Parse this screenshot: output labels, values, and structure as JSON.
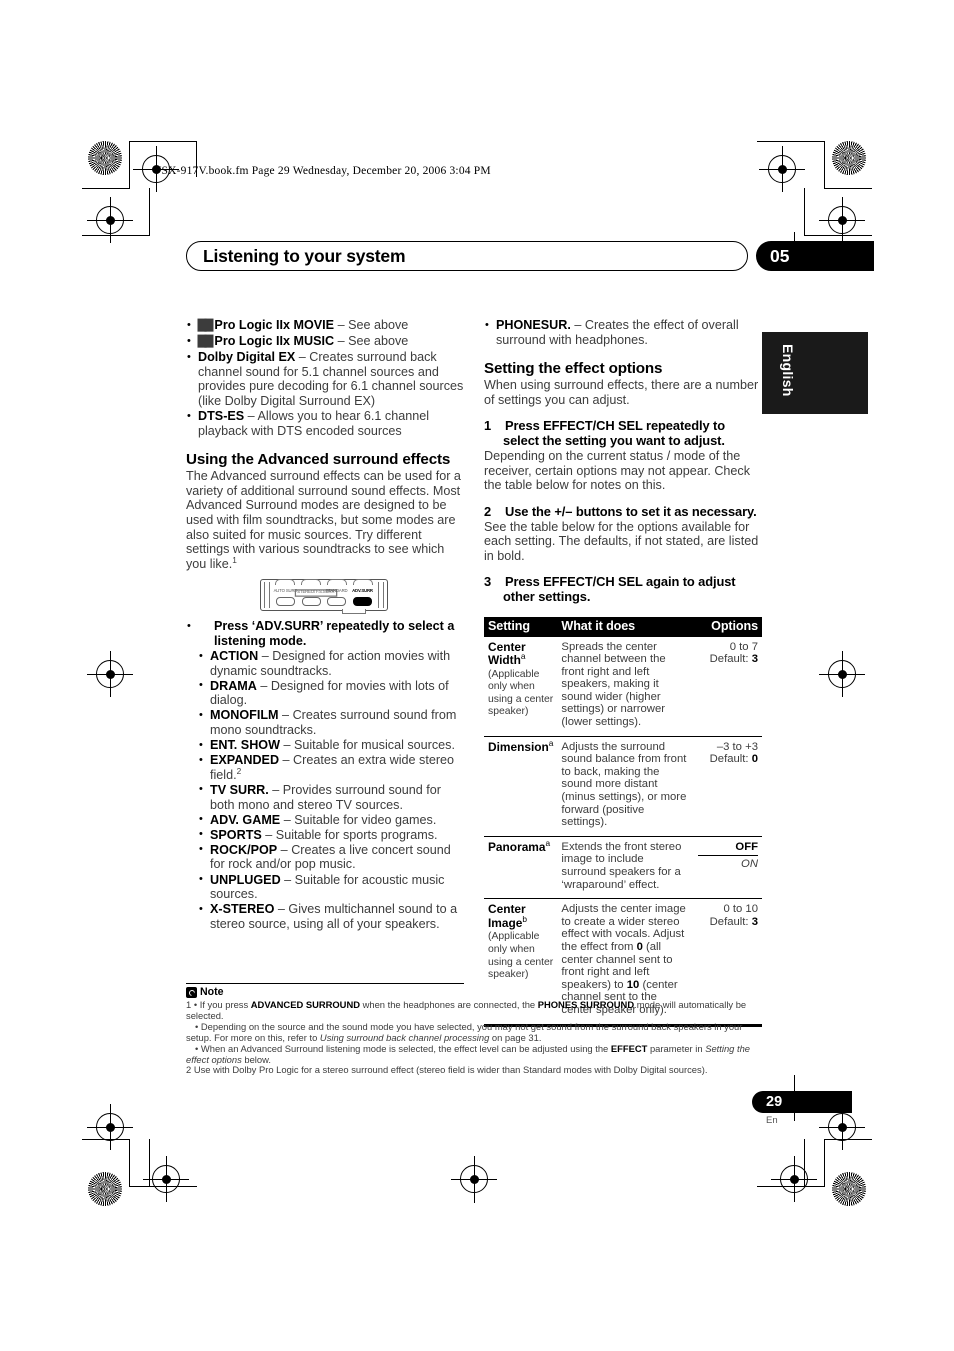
{
  "file_header": "VSX-917V.book.fm  Page 29  Wednesday, December 20, 2006  3:04 PM",
  "header": {
    "title": "Listening to your system",
    "chapter": "05",
    "language_tab": "English"
  },
  "footer": {
    "page_number": "29",
    "page_suffix": "En"
  },
  "left_column": {
    "mode_bullets": [
      {
        "dolby_symbol": "██",
        "term": "Pro Logic IIx MOVIE",
        "desc": " – See above"
      },
      {
        "dolby_symbol": "██",
        "term": "Pro Logic IIx MUSIC",
        "desc": " – See above"
      },
      {
        "dolby_symbol": "",
        "term": "Dolby Digital EX",
        "desc": " – Creates surround back channel sound for 5.1 channel sources and provides pure decoding for 6.1 channel sources (like Dolby Digital Surround EX)"
      },
      {
        "dolby_symbol": "",
        "term": "DTS-ES",
        "desc": " – Allows you to hear 6.1 channel playback with DTS encoded sources"
      }
    ],
    "section_heading": "Using the Advanced surround effects",
    "section_body_1": "The Advanced surround effects can be used for a variety of additional surround sound effects. Most Advanced Surround modes are designed to be used with film soundtracks, but some modes are also suited for music sources. Try different settings with various soundtracks to see which you like.",
    "section_body_1_footnote": "1",
    "remote": {
      "buttons": [
        {
          "label": "AUTO SURR",
          "active": false,
          "boxed": false
        },
        {
          "label": "STEREO/ F.S.SURR",
          "active": false,
          "boxed": true
        },
        {
          "label": "STANDARD",
          "active": false,
          "boxed": false
        },
        {
          "label": "ADV.SURR",
          "active": true,
          "boxed": false
        }
      ]
    },
    "instruction": "Press  ‘ADV.SURR’ repeatedly to select a listening mode.",
    "listening_modes": [
      {
        "term": "ACTION",
        "desc": " – Designed for action movies with dynamic soundtracks."
      },
      {
        "term": "DRAMA",
        "desc": " – Designed for movies with lots of dialog."
      },
      {
        "term": "MONOFILM",
        "desc": " – Creates surround sound from mono soundtracks."
      },
      {
        "term": "ENT. SHOW",
        "desc": " – Suitable for musical sources."
      },
      {
        "term": "EXPANDED",
        "desc": " – Creates an extra wide stereo field.",
        "footnote": "2"
      },
      {
        "term": "TV SURR.",
        "desc": " – Provides surround sound for both mono and stereo TV sources."
      },
      {
        "term": "ADV. GAME",
        "desc": " – Suitable for video games."
      },
      {
        "term": "SPORTS",
        "desc": " – Suitable for sports programs."
      },
      {
        "term": "ROCK/POP",
        "desc": " – Creates a live concert sound for rock and/or pop music."
      },
      {
        "term": "UNPLUGED",
        "desc": " – Suitable for acoustic music sources."
      },
      {
        "term": "X-STEREO",
        "desc": " – Gives multichannel sound to a stereo source, using all of your speakers."
      }
    ]
  },
  "right_column": {
    "phonesur": {
      "term": "PHONESUR.",
      "desc": " – Creates the effect of overall surround with headphones."
    },
    "section_heading": "Setting the effect options",
    "section_body": "When using surround effects, there are a number of settings you can adjust.",
    "steps": [
      {
        "num": "1",
        "title": "Press EFFECT/CH SEL repeatedly to select the setting you want to adjust.",
        "body": "Depending on the current status / mode of the receiver, certain options may not appear. Check the table below for notes on this."
      },
      {
        "num": "2",
        "title": "Use the +/– buttons to set it as necessary.",
        "body": "See the table below for the options available for each setting. The defaults, if not stated, are listed in bold."
      },
      {
        "num": "3",
        "title": "Press EFFECT/CH SEL again to adjust other settings.",
        "body": ""
      }
    ],
    "table": {
      "headers": [
        "Setting",
        "What it does",
        "Options"
      ],
      "rows": [
        {
          "setting_name": "Center Width",
          "setting_footnote": "a",
          "setting_note": "(Applicable only when using a center speaker)",
          "what": "Spreads the center channel between the front right and left speakers, making it sound wider (higher settings) or narrower (lower settings).",
          "options_range": "0 to 7",
          "options_default_label": "Default: ",
          "options_default_value": "3"
        },
        {
          "setting_name": "Dimension",
          "setting_footnote": "a",
          "setting_note": "",
          "what": "Adjusts the surround sound balance from front to back, making the sound more distant (minus settings), or more forward (positive settings).",
          "options_range": "–3 to +3",
          "options_default_label": "Default: ",
          "options_default_value": "0"
        },
        {
          "setting_name": "Panorama",
          "setting_footnote": "a",
          "setting_note": "",
          "what": "Extends the front stereo image to include surround speakers for a ‘wraparound’ effect.",
          "options_on_off": {
            "default": "OFF",
            "alternate": "ON"
          }
        },
        {
          "setting_name": "Center Image",
          "setting_footnote": "b",
          "setting_note": "(Applicable only when using a center speaker)",
          "what_part1": "Adjusts the center image to create a wider stereo effect with vocals. Adjust the effect from ",
          "what_bold1": "0",
          "what_part2": " (all center channel sent to front right and left speakers) to ",
          "what_bold2": "10",
          "what_part3": " (center channel sent to the center speaker only).",
          "options_range": "0 to 10",
          "options_default_label": "Default: ",
          "options_default_value": "3"
        }
      ]
    }
  },
  "notes": {
    "label": "Note",
    "items": [
      {
        "marker": "1",
        "text_parts": [
          "• If you press ",
          "ADVANCED SURROUND",
          " when the headphones are connected, the ",
          "PHONES SURROUND",
          " mode will automatically be selected."
        ]
      },
      {
        "marker": "",
        "text_parts": [
          "• Depending on the source and the sound mode you have selected, you may not get sound from the surround back speakers in your setup. For more on this, refer to ",
          "Using surround back channel processing",
          " on page 31."
        ]
      },
      {
        "marker": "",
        "text_parts": [
          "• When an Advanced Surround listening mode is selected, the effect level can be adjusted using the ",
          "EFFECT",
          " parameter in ",
          "Setting the effect options",
          " below."
        ]
      },
      {
        "marker": "2",
        "text_parts": [
          "Use with Dolby Pro Logic for a stereo surround effect (stereo field is wider than Standard modes with Dolby Digital sources)."
        ]
      }
    ]
  }
}
